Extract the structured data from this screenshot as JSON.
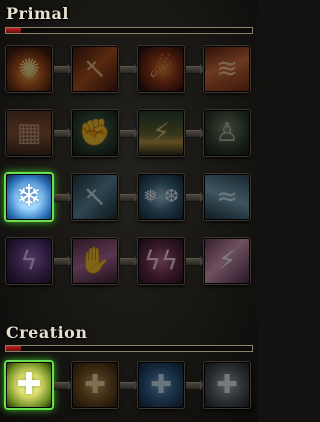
{
  "sections": [
    {
      "title": "Primal",
      "progress_fraction": 0.06,
      "rows": [
        [
          "flame-burst-icon",
          "flaming-sword-icon",
          "fireball-icon",
          "inferno-icon"
        ],
        [
          "stone-armor-icon",
          "earth-fist-icon",
          "earthquake-icon",
          "petrify-icon"
        ],
        [
          "winters-grasp-icon",
          "frost-weapon-icon",
          "cone-of-cold-icon",
          "blizzard-icon"
        ],
        [
          "shock-icon",
          "lightning-hands-icon",
          "chain-lightning-icon",
          "tempest-icon"
        ]
      ],
      "active": [
        "winters-grasp-icon"
      ]
    },
    {
      "title": "Creation",
      "progress_fraction": 0.06,
      "rows": [
        [
          "heal-icon",
          "rejuvenate-icon",
          "regeneration-icon",
          "mass-rejuvenation-icon"
        ]
      ],
      "active": [
        "heal-icon"
      ]
    }
  ],
  "colors": {
    "frame_gold": "#8b8468",
    "progress_red": "#c22222",
    "active_green": "#69e052"
  }
}
